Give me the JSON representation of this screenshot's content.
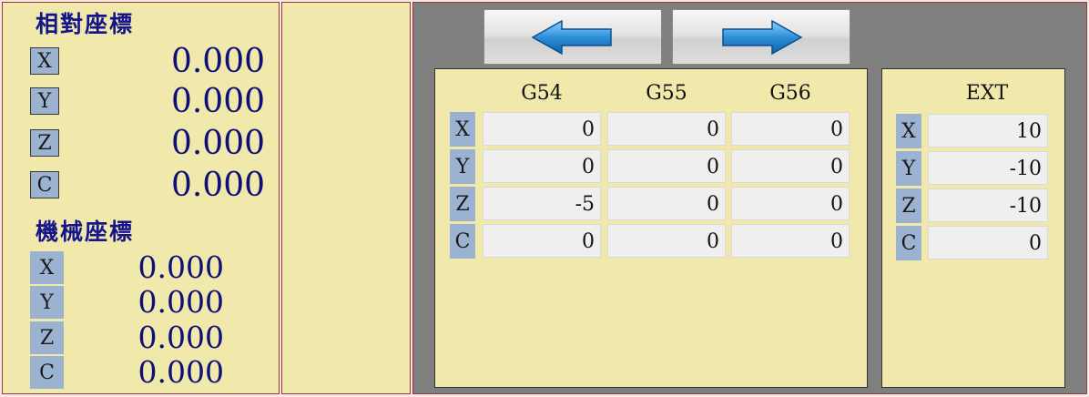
{
  "relative": {
    "title": "相對座標",
    "axes": [
      {
        "label": "X",
        "value": "0.000"
      },
      {
        "label": "Y",
        "value": "0.000"
      },
      {
        "label": "Z",
        "value": "0.000"
      },
      {
        "label": "C",
        "value": "0.000"
      }
    ]
  },
  "machine": {
    "title": "機械座標",
    "axes": [
      {
        "label": "X",
        "value": "0.000"
      },
      {
        "label": "Y",
        "value": "0.000"
      },
      {
        "label": "Z",
        "value": "0.000"
      },
      {
        "label": "C",
        "value": "0.000"
      }
    ]
  },
  "nav": {
    "prev_icon": "arrow-left-icon",
    "next_icon": "arrow-right-icon"
  },
  "offsets": {
    "columns": [
      "G54",
      "G55",
      "G56"
    ],
    "axes": [
      "X",
      "Y",
      "Z",
      "C"
    ],
    "values": [
      [
        "0",
        "0",
        "0"
      ],
      [
        "0",
        "0",
        "0"
      ],
      [
        "-5",
        "0",
        "0"
      ],
      [
        "0",
        "0",
        "0"
      ]
    ]
  },
  "ext": {
    "column": "EXT",
    "axes": [
      "X",
      "Y",
      "Z",
      "C"
    ],
    "values": [
      "10",
      "-10",
      "-10",
      "0"
    ]
  },
  "colors": {
    "panel_bg": "#f1e9ab",
    "axis_bg": "#9bb3d1",
    "value_text": "#0f0f7a",
    "frame_bg": "#7f7f7f",
    "arrow_blue": "#2e8fd9"
  }
}
